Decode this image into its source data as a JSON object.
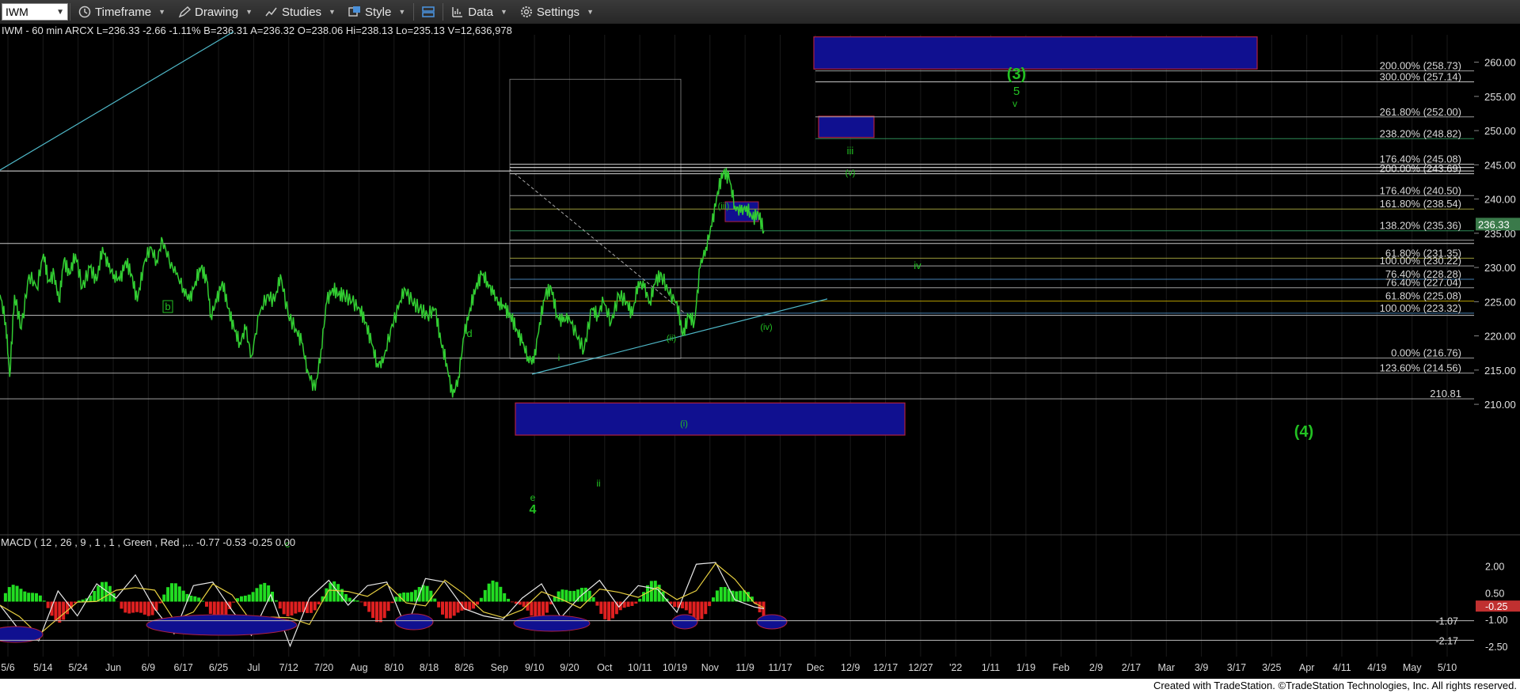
{
  "toolbar": {
    "symbol": "IWM",
    "timeframe": "Timeframe",
    "drawing": "Drawing",
    "studies": "Studies",
    "style": "Style",
    "data": "Data",
    "settings": "Settings"
  },
  "header": {
    "info": "IWM - 60 min  ARCX  L=236.33  -2.66  -1.11%  B=236.31  A=236.32  O=238.06  Hi=238.13  Lo=235.13  V=12,636,978"
  },
  "macd_header": "MACD ( 12 , 26 , 9 , 1 , 1 , Green , Red ,...  -0.77  -0.53  -0.25  0.00",
  "footer": "Created with TradeStation. ©TradeStation Technologies, Inc. All rights reserved.",
  "colors": {
    "price": "#32cd32",
    "wave_label": "#22c022",
    "fib_text": "#d8d8d8",
    "box_fill": "#101090",
    "box_stroke": "#b02040",
    "teal_line": "#4fb8c8",
    "last_price_box": "#3a7a4a",
    "macd_pos": "#22dd22",
    "macd_neg": "#e02020"
  },
  "chart_data": [
    {
      "type": "line",
      "title": "IWM - 60 min",
      "ylim": [
        205.5,
        264
      ],
      "x_ticks": [
        "5/6",
        "5/14",
        "5/24",
        "Jun",
        "6/9",
        "6/17",
        "6/25",
        "Jul",
        "7/12",
        "7/20",
        "Aug",
        "8/10",
        "8/18",
        "8/26",
        "Sep",
        "9/10",
        "9/20",
        "Oct",
        "10/11",
        "10/19",
        "Nov",
        "11/9",
        "11/17",
        "Dec",
        "12/9",
        "12/17",
        "12/27",
        "'22",
        "1/11",
        "1/19",
        "Feb",
        "2/9",
        "2/17",
        "Mar",
        "3/9",
        "3/17",
        "3/25",
        "Apr",
        "4/11",
        "4/19",
        "May",
        "5/10"
      ],
      "y_ticks": [
        210,
        215,
        220,
        225,
        230,
        235,
        240,
        245,
        250,
        255,
        260
      ],
      "last_price": "236.33",
      "price_path": [
        [
          0,
          226
        ],
        [
          6,
          222
        ],
        [
          10,
          214
        ],
        [
          15,
          226
        ],
        [
          22,
          221
        ],
        [
          30,
          229
        ],
        [
          38,
          227
        ],
        [
          45,
          232
        ],
        [
          50,
          228
        ],
        [
          56,
          229
        ],
        [
          61,
          225
        ],
        [
          66,
          231
        ],
        [
          72,
          229
        ],
        [
          78,
          232
        ],
        [
          85,
          227
        ],
        [
          93,
          230
        ],
        [
          100,
          228
        ],
        [
          106,
          233
        ],
        [
          112,
          230
        ],
        [
          118,
          229
        ],
        [
          124,
          228
        ],
        [
          130,
          231
        ],
        [
          136,
          229
        ],
        [
          142,
          225
        ],
        [
          148,
          230
        ],
        [
          155,
          233
        ],
        [
          162,
          231
        ],
        [
          168,
          234
        ],
        [
          175,
          231
        ],
        [
          182,
          229
        ],
        [
          190,
          227
        ],
        [
          196,
          225
        ],
        [
          202,
          228
        ],
        [
          208,
          230
        ],
        [
          214,
          228
        ],
        [
          218,
          223
        ],
        [
          224,
          225
        ],
        [
          230,
          228
        ],
        [
          236,
          224
        ],
        [
          242,
          221
        ],
        [
          248,
          219
        ],
        [
          254,
          221
        ],
        [
          260,
          217
        ],
        [
          268,
          223
        ],
        [
          276,
          226
        ],
        [
          284,
          225
        ],
        [
          290,
          229
        ],
        [
          298,
          223
        ],
        [
          306,
          221
        ],
        [
          312,
          219
        ],
        [
          318,
          215
        ],
        [
          326,
          212
        ],
        [
          332,
          218
        ],
        [
          338,
          225
        ],
        [
          344,
          227
        ],
        [
          350,
          226
        ],
        [
          356,
          226
        ],
        [
          364,
          225
        ],
        [
          372,
          224
        ],
        [
          378,
          222
        ],
        [
          384,
          219
        ],
        [
          390,
          216
        ],
        [
          396,
          216
        ],
        [
          404,
          221
        ],
        [
          412,
          224
        ],
        [
          418,
          227
        ],
        [
          426,
          225
        ],
        [
          434,
          224
        ],
        [
          442,
          223
        ],
        [
          450,
          224
        ],
        [
          456,
          219
        ],
        [
          462,
          216
        ],
        [
          468,
          211
        ],
        [
          474,
          214
        ],
        [
          480,
          220
        ],
        [
          486,
          224
        ],
        [
          492,
          227
        ],
        [
          498,
          229
        ],
        [
          504,
          228
        ],
        [
          510,
          226
        ],
        [
          516,
          225
        ],
        [
          522,
          224
        ],
        [
          528,
          223
        ],
        [
          534,
          221
        ],
        [
          540,
          219
        ],
        [
          546,
          217
        ],
        [
          552,
          216
        ],
        [
          558,
          222
        ],
        [
          564,
          226
        ],
        [
          570,
          227
        ],
        [
          576,
          223
        ],
        [
          582,
          222
        ],
        [
          588,
          223
        ],
        [
          596,
          220
        ],
        [
          604,
          218
        ],
        [
          612,
          224
        ],
        [
          618,
          223
        ],
        [
          624,
          225
        ],
        [
          632,
          222
        ],
        [
          640,
          226
        ],
        [
          648,
          225
        ],
        [
          654,
          223
        ],
        [
          660,
          228
        ],
        [
          666,
          227
        ],
        [
          672,
          225
        ],
        [
          678,
          228
        ],
        [
          684,
          229
        ],
        [
          692,
          226
        ],
        [
          700,
          225
        ],
        [
          706,
          220
        ],
        [
          712,
          223
        ],
        [
          718,
          222
        ],
        [
          724,
          230
        ],
        [
          730,
          233
        ],
        [
          736,
          236
        ],
        [
          742,
          241
        ],
        [
          748,
          244
        ],
        [
          754,
          243
        ],
        [
          760,
          239
        ],
        [
          766,
          238
        ],
        [
          772,
          239
        ],
        [
          778,
          237
        ],
        [
          784,
          238
        ],
        [
          790,
          235.3
        ]
      ],
      "macd_ylim": [
        -3.0,
        2.6
      ],
      "macd_y_ticks": [
        2.0,
        0.5,
        -1.0,
        -2.5
      ],
      "macd_labels": [
        "2.00",
        "0.50",
        "-0.25",
        "-1.00",
        "-1.07",
        "-2.17",
        "-2.50"
      ],
      "macd_line": [
        [
          0,
          -0.2
        ],
        [
          20,
          -1.6
        ],
        [
          40,
          -2.2
        ],
        [
          60,
          0.6
        ],
        [
          80,
          -0.8
        ],
        [
          100,
          1.0
        ],
        [
          120,
          0.2
        ],
        [
          140,
          1.5
        ],
        [
          160,
          -0.4
        ],
        [
          180,
          -1.8
        ],
        [
          200,
          0.9
        ],
        [
          220,
          1.1
        ],
        [
          240,
          -0.5
        ],
        [
          260,
          -1.9
        ],
        [
          280,
          0.4
        ],
        [
          300,
          -2.5
        ],
        [
          320,
          0.2
        ],
        [
          340,
          1.2
        ],
        [
          360,
          -0.2
        ],
        [
          380,
          0.9
        ],
        [
          400,
          1.1
        ],
        [
          420,
          -1.5
        ],
        [
          440,
          1.3
        ],
        [
          460,
          1.1
        ],
        [
          480,
          -0.4
        ],
        [
          500,
          -0.8
        ],
        [
          520,
          -1.0
        ],
        [
          540,
          0.2
        ],
        [
          560,
          1.0
        ],
        [
          580,
          -0.9
        ],
        [
          600,
          0.3
        ],
        [
          620,
          1.2
        ],
        [
          640,
          -0.3
        ],
        [
          660,
          0.9
        ],
        [
          680,
          0.7
        ],
        [
          700,
          -0.6
        ],
        [
          720,
          2.1
        ],
        [
          740,
          2.2
        ],
        [
          760,
          0.1
        ],
        [
          780,
          -0.3
        ],
        [
          790,
          -0.4
        ]
      ],
      "fib_levels": [
        {
          "label": "200.00% (258.73)",
          "v": 258.73,
          "color": "#a0a0a0"
        },
        {
          "label": "300.00% (257.14)",
          "v": 257.14,
          "color": "#d0d0d0"
        },
        {
          "label": "261.80% (252.00)",
          "v": 252.0,
          "color": "#a0a0a0"
        },
        {
          "label": "238.20% (248.82)",
          "v": 248.82,
          "color": "#2e8b57"
        },
        {
          "label": "176.40% (245.08)",
          "v": 245.08,
          "color": "#d0d0d0"
        },
        {
          "label": "200.00% (243.69)",
          "v": 243.69,
          "color": "#d0d0d0"
        },
        {
          "label": "176.40% (240.50)",
          "v": 240.5,
          "color": "#a0a0a0"
        },
        {
          "label": "161.80% (238.54)",
          "v": 238.54,
          "color": "#9a9a3a"
        },
        {
          "label": "138.20% (235.36)",
          "v": 235.36,
          "color": "#2e8b57"
        },
        {
          "label": "61.80% (231.35)",
          "v": 231.35,
          "color": "#9a9a3a"
        },
        {
          "label": "100.00% (230.22)",
          "v": 230.22,
          "color": "#a0a0a0"
        },
        {
          "label": "76.40% (228.28)",
          "v": 228.28,
          "color": "#4682b4"
        },
        {
          "label": "76.40% (227.04)",
          "v": 227.04,
          "color": "#a0a0a0"
        },
        {
          "label": "61.80% (225.08)",
          "v": 225.08,
          "color": "#b8a000"
        },
        {
          "label": "100.00% (223.32)",
          "v": 223.32,
          "color": "#4682b4"
        },
        {
          "label": "0.00% (216.76)",
          "v": 216.76,
          "color": "#a0a0a0"
        },
        {
          "label": "123.60% (214.56)",
          "v": 214.56,
          "color": "#a0a0a0"
        },
        {
          "label": "210.81",
          "v": 210.81,
          "color": "#a0a0a0"
        }
      ],
      "wave_labels": [
        {
          "text": "(3)",
          "big": true
        },
        {
          "text": "5",
          "big": false
        },
        {
          "text": "v",
          "big": false
        },
        {
          "text": "iii",
          "big": false
        },
        {
          "text": "(v)",
          "big": false
        },
        {
          "text": "(iii)",
          "big": false
        },
        {
          "text": "iv",
          "big": false
        },
        {
          "text": "(iv)",
          "big": false
        },
        {
          "text": "b",
          "big": false
        },
        {
          "text": "d",
          "big": false
        },
        {
          "text": "i",
          "big": false
        },
        {
          "text": "(ii)",
          "big": false
        },
        {
          "text": "(i)",
          "big": false
        },
        {
          "text": "ii",
          "big": false
        },
        {
          "text": "e",
          "big": false
        },
        {
          "text": "4",
          "big": true
        },
        {
          "text": "c",
          "big": false
        },
        {
          "text": "(4)",
          "big": true
        }
      ]
    }
  ]
}
